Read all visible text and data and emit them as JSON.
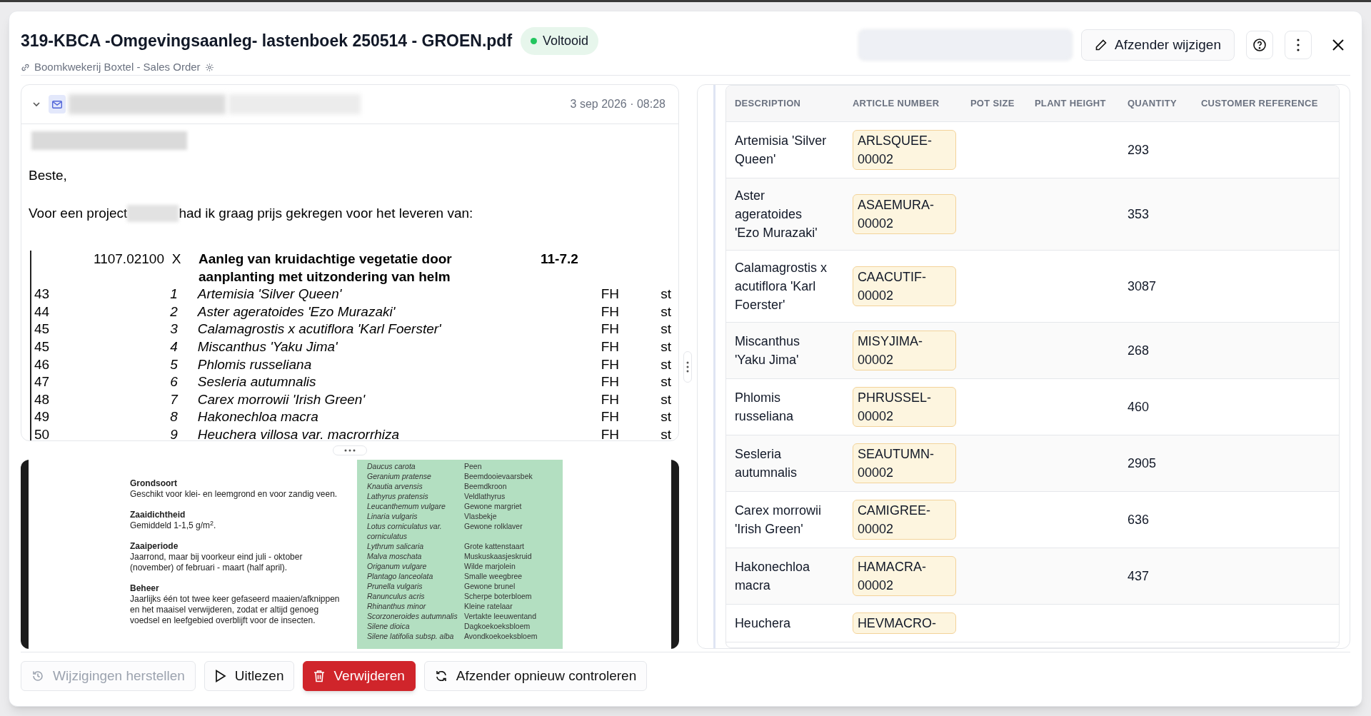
{
  "header": {
    "title": "319-KBCA -Omgevingsaanleg- lastenboek 250514 - GROEN.pdf",
    "status": "Voltooid",
    "subtitle": "Boomkwekerij Boxtel - Sales Order",
    "action": "Afzender wijzigen"
  },
  "email": {
    "date": "3 sep 2026 · 08:28",
    "greeting": "Beste,",
    "intro_before": "Voor een project",
    "intro_after": "had ik graag prijs gekregen voor het leveren van:",
    "section": {
      "code": "1107.02100",
      "mark": "X",
      "title": "Aanleg van kruidachtige vegetatie door aanplanting met uitzondering van helm",
      "ref": "11-7.2"
    },
    "lines": [
      {
        "line": "43",
        "index": "1",
        "name": "Artemisia 'Silver Queen'",
        "unit": "FH",
        "measure": "st"
      },
      {
        "line": "44",
        "index": "2",
        "name": "Aster ageratoides 'Ezo Murazaki'",
        "unit": "FH",
        "measure": "st"
      },
      {
        "line": "45",
        "index": "3",
        "name": "Calamagrostis x acutiflora 'Karl Foerster'",
        "unit": "FH",
        "measure": "st"
      },
      {
        "line": "45",
        "index": "4",
        "name": "Miscanthus 'Yaku Jima'",
        "unit": "FH",
        "measure": "st"
      },
      {
        "line": "46",
        "index": "5",
        "name": "Phlomis russeliana",
        "unit": "FH",
        "measure": "st"
      },
      {
        "line": "47",
        "index": "6",
        "name": "Sesleria autumnalis",
        "unit": "FH",
        "measure": "st"
      },
      {
        "line": "48",
        "index": "7",
        "name": "Carex morrowii 'Irish Green'",
        "unit": "FH",
        "measure": "st"
      },
      {
        "line": "49",
        "index": "8",
        "name": "Hakonechloa macra",
        "unit": "FH",
        "measure": "st"
      },
      {
        "line": "50",
        "index": "9",
        "name": "Heuchera villosa var. macrorrhiza",
        "unit": "FH",
        "measure": "st"
      }
    ]
  },
  "document": {
    "sections": [
      {
        "heading": "Grondsoort",
        "text": "Geschikt voor klei- en leemgrond en voor zandig veen."
      },
      {
        "heading": "Zaaidichtheid",
        "text": "Gemiddeld 1-1,5 g/m$^{2}$."
      },
      {
        "heading": "Zaaiperiode",
        "text": "Jaarrond, maar bij voorkeur eind juli - oktober (november) of februari - maart (half april)."
      },
      {
        "heading": "Beheer",
        "text": "Jaarlijks één tot twee keer gefaseerd maaien/afknippen en het maaisel verwijderen, zodat er altijd genoeg voedsel en leefgebied overblijft voor de insecten."
      }
    ],
    "species": [
      {
        "latin": "Daucus carota",
        "common": "Peen"
      },
      {
        "latin": "Geranium pratense",
        "common": "Beemdooievaarsbek"
      },
      {
        "latin": "Knautia arvensis",
        "common": "Beemdkroon"
      },
      {
        "latin": "Lathyrus pratensis",
        "common": "Veldlathyrus"
      },
      {
        "latin": "Leucanthemum vulgare",
        "common": "Gewone margriet"
      },
      {
        "latin": "Linaria vulgaris",
        "common": "Vlasbekje"
      },
      {
        "latin": "Lotus corniculatus var. corniculatus",
        "common": "Gewone rolklaver"
      },
      {
        "latin": "Lythrum salicaria",
        "common": "Grote kattenstaart"
      },
      {
        "latin": "Malva moschata",
        "common": "Muskuskaasjeskruid"
      },
      {
        "latin": "Origanum vulgare",
        "common": "Wilde marjolein"
      },
      {
        "latin": "Plantago lanceolata",
        "common": "Smalle weegbree"
      },
      {
        "latin": "Prunella vulgaris",
        "common": "Gewone brunel"
      },
      {
        "latin": "Ranunculus acris",
        "common": "Scherpe boterbloem"
      },
      {
        "latin": "Rhinanthus minor",
        "common": "Kleine ratelaar"
      },
      {
        "latin": "Scorzoneroides autumnalis",
        "common": "Vertakte leeuwentand"
      },
      {
        "latin": "Silene dioica",
        "common": "Dagkoekoeksbloem"
      },
      {
        "latin": "Silene latifolia subsp. alba",
        "common": "Avondkoekoeksbloem"
      }
    ]
  },
  "table": {
    "columns": [
      "DESCRIPTION",
      "ARTICLE NUMBER",
      "POT SIZE",
      "PLANT HEIGHT",
      "QUANTITY",
      "CUSTOMER REFERENCE"
    ],
    "rows": [
      {
        "description": "Artemisia 'Silver Queen'",
        "article_number": "ARLSQUEE-00002",
        "quantity": "293"
      },
      {
        "description": "Aster ageratoides 'Ezo Murazaki'",
        "article_number": "ASAEMURA-00002",
        "quantity": "353"
      },
      {
        "description": "Calamagrostis x acutiflora 'Karl Foerster'",
        "article_number": "CAACUTIF-00002",
        "quantity": "3087"
      },
      {
        "description": "Miscanthus 'Yaku Jima'",
        "article_number": "MISYJIMA-00002",
        "quantity": "268"
      },
      {
        "description": "Phlomis russeliana",
        "article_number": "PHRUSSEL-00002",
        "quantity": "460"
      },
      {
        "description": "Sesleria autumnalis",
        "article_number": "SEAUTUMN-00002",
        "quantity": "2905"
      },
      {
        "description": "Carex morrowii 'Irish Green'",
        "article_number": "CAMIGREE-00002",
        "quantity": "636"
      },
      {
        "description": "Hakonechloa macra",
        "article_number": "HAMACRA-00002",
        "quantity": "437"
      },
      {
        "description": "Heuchera",
        "article_number": "HEVMACRO-"
      }
    ]
  },
  "footer": {
    "buttons": [
      {
        "label": "Wijzigingen herstellen",
        "kind": "restore",
        "disabled": true
      },
      {
        "label": "Uitlezen",
        "kind": "play",
        "disabled": false
      },
      {
        "label": "Verwijderen",
        "kind": "delete",
        "disabled": false
      },
      {
        "label": "Afzender opnieuw controleren",
        "kind": "recheck",
        "disabled": false
      }
    ]
  }
}
